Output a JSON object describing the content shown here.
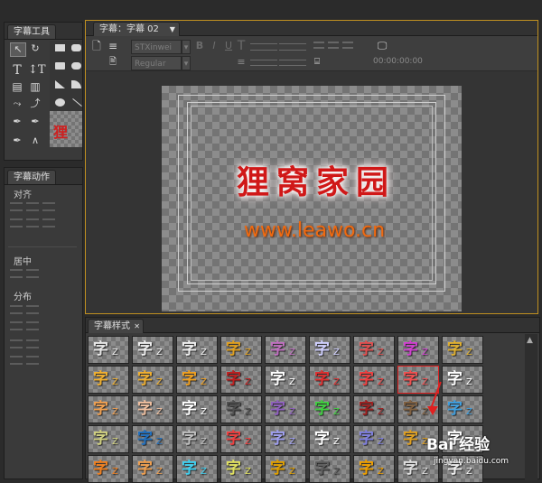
{
  "tools_panel": {
    "title": "字幕工具"
  },
  "actions_panel": {
    "title": "字幕动作",
    "align_label": "对齐",
    "center_label": "居中",
    "distribute_label": "分布"
  },
  "editor": {
    "tab_label": "字幕：字幕 02",
    "font_family": "STXinwei",
    "font_style": "Regular",
    "timecode": "00:00:00:00",
    "canvas_title": "狸窝家园",
    "canvas_url": "www.leawo.cn"
  },
  "styles_panel": {
    "tab_label": "字幕样式",
    "swatch_glyph": "字",
    "swatch_sub": "Z",
    "swatches": [
      [
        "#e8e8e8",
        "#f0f0f0",
        "#f0f0f0",
        "#e0a020",
        "#c070c0",
        "#d0d0ff",
        "#e05050",
        "#d040d0",
        "#e0b030"
      ],
      [
        "#f0b030",
        "#f0b030",
        "#f0a020",
        "#c02020",
        "#ffffff",
        "#e03030",
        "#f04040",
        "#f05050",
        "#ffffff"
      ],
      [
        "#f0a050",
        "#f0c0a0",
        "#ffffff",
        "#505050",
        "#9060c0",
        "#40d040",
        "#a02020",
        "#806040",
        "#40a0e0"
      ],
      [
        "#d0d080",
        "#2070c0",
        "#c0c0c0",
        "#f04040",
        "#a0a0f0",
        "#ffffff",
        "#8080e0",
        "#e0a020",
        "#ffffff"
      ],
      [
        "#f08020",
        "#f0a050",
        "#40d0f0",
        "#e0e060",
        "#e0a000",
        "#606060",
        "#f0a000",
        "#e0e0e0",
        "#f0f0f0"
      ]
    ]
  },
  "watermark": {
    "text": "Bai 经验",
    "url": "jingyan.baidu.com"
  }
}
